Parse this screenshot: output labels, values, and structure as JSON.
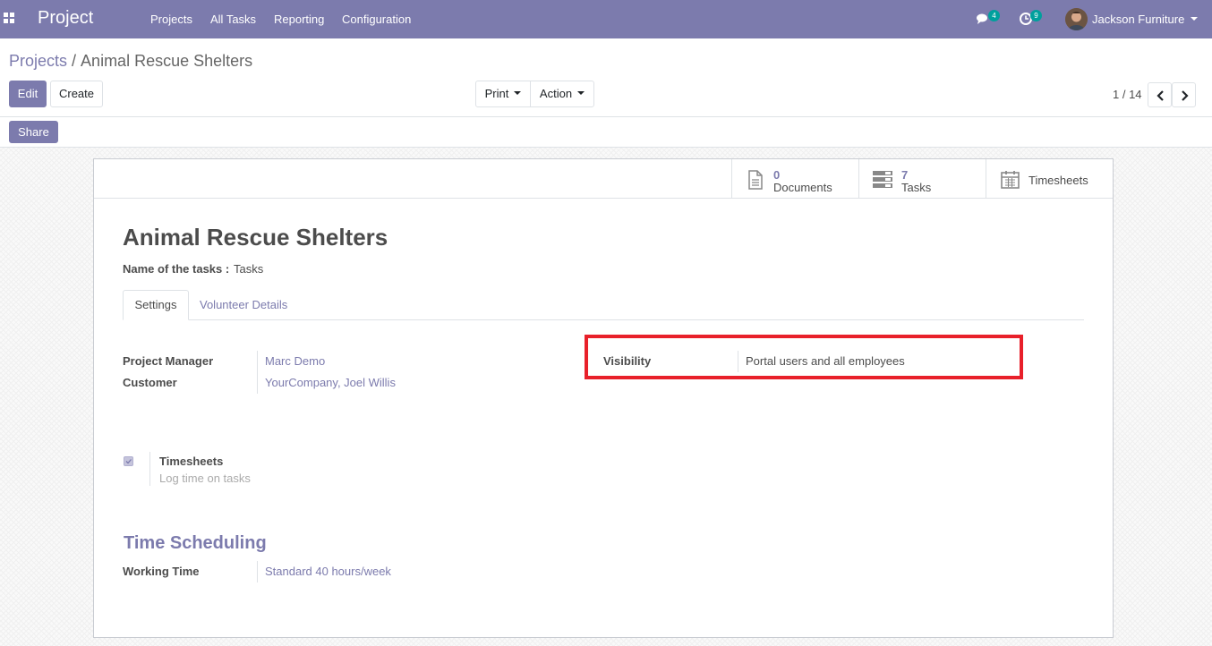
{
  "navbar": {
    "app_name": "Project",
    "menus": [
      "Projects",
      "All Tasks",
      "Reporting",
      "Configuration"
    ],
    "messages_count": "4",
    "activities_count": "9",
    "user_name": "Jackson Furniture",
    "icons": {
      "apps": "apps-grid-icon",
      "messages": "chat-bubbles-icon",
      "activities": "clock-icon",
      "user_menu": "caret-down-icon"
    }
  },
  "breadcrumb": {
    "parent": "Projects",
    "separator": "/",
    "current": "Animal Rescue Shelters"
  },
  "toolbar": {
    "edit_label": "Edit",
    "create_label": "Create",
    "print_label": "Print",
    "action_label": "Action",
    "share_label": "Share"
  },
  "pager": {
    "value": "1 / 14",
    "icons": {
      "prev": "chevron-left-icon",
      "next": "chevron-right-icon"
    }
  },
  "stat_buttons": [
    {
      "value": "0",
      "label": "Documents",
      "icon": "document-icon"
    },
    {
      "value": "7",
      "label": "Tasks",
      "icon": "tasks-icon"
    },
    {
      "value": "",
      "label": "Timesheets",
      "icon": "calendar-icon"
    }
  ],
  "form": {
    "title": "Animal Rescue Shelters",
    "tasks_name_label": "Name of the tasks :",
    "tasks_name_value": "Tasks",
    "tabs": [
      "Settings",
      "Volunteer Details"
    ],
    "fields": {
      "project_manager_label": "Project Manager",
      "project_manager_value": "Marc Demo",
      "customer_label": "Customer",
      "customer_value": "YourCompany, Joel Willis",
      "visibility_label": "Visibility",
      "visibility_value": "Portal users and all employees"
    },
    "timesheets": {
      "checked": true,
      "label": "Timesheets",
      "help": "Log time on tasks"
    },
    "time_scheduling": {
      "section_title": "Time Scheduling",
      "working_time_label": "Working Time",
      "working_time_value": "Standard 40 hours/week"
    }
  },
  "colors": {
    "brand": "#7c7bad",
    "badge": "#00a09d",
    "highlight": "#e8202a"
  }
}
